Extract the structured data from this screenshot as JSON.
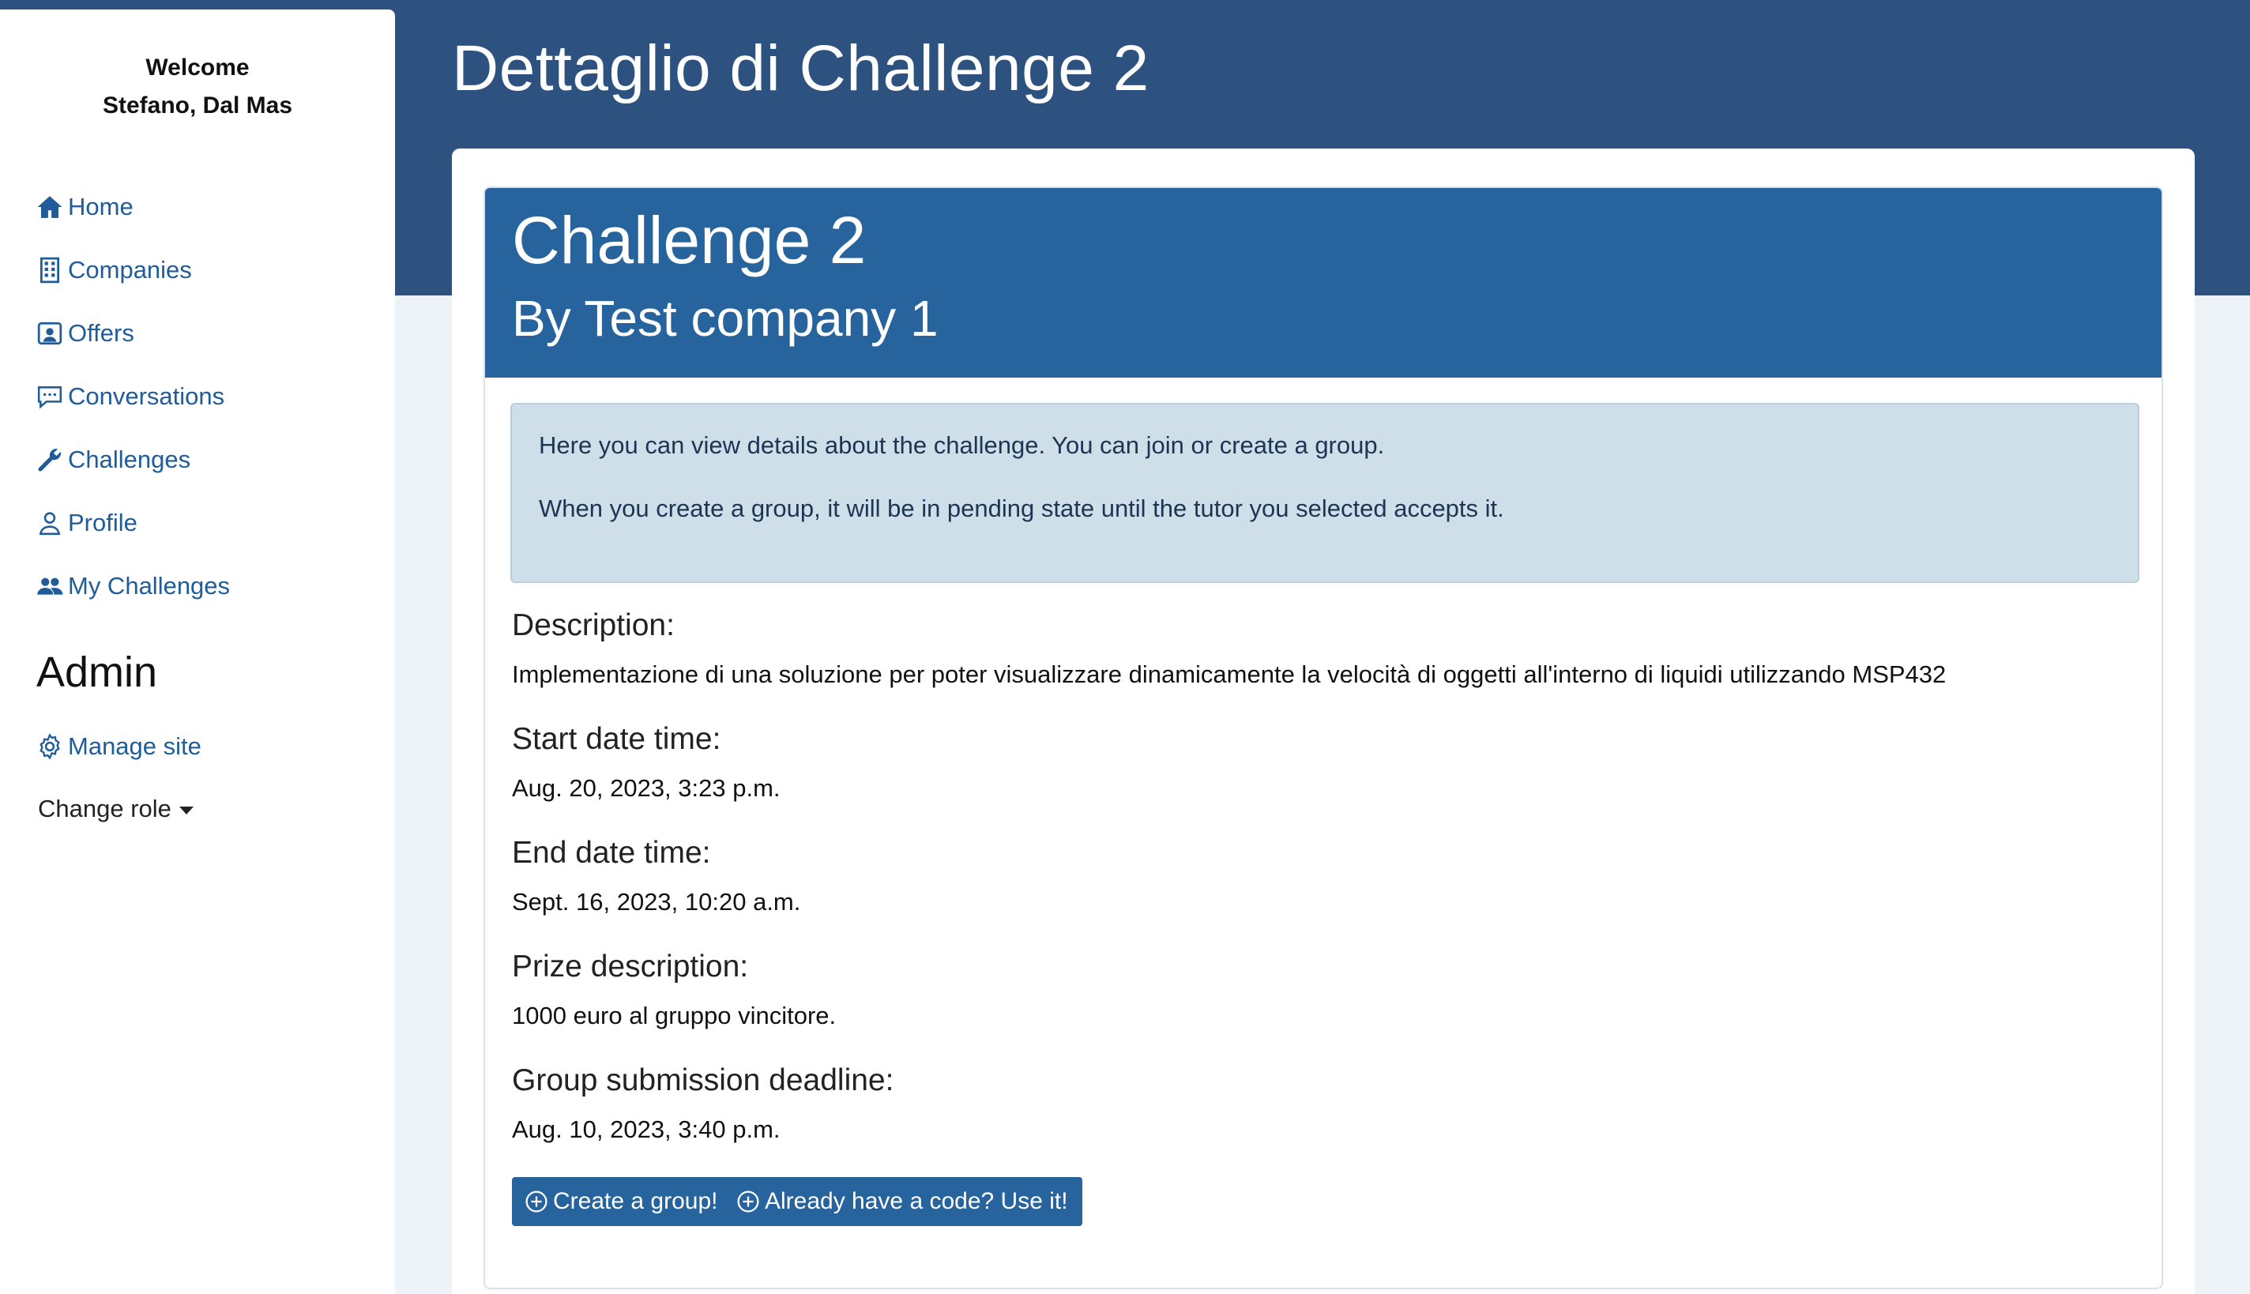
{
  "sidebar": {
    "welcome_line1": "Welcome",
    "welcome_line2": "Stefano, Dal Mas",
    "items": [
      {
        "label": "Home",
        "icon": "home-icon"
      },
      {
        "label": "Companies",
        "icon": "building-icon"
      },
      {
        "label": "Offers",
        "icon": "person-badge-icon"
      },
      {
        "label": "Conversations",
        "icon": "chat-icon"
      },
      {
        "label": "Challenges",
        "icon": "wrench-icon"
      },
      {
        "label": "Profile",
        "icon": "person-icon"
      },
      {
        "label": "My Challenges",
        "icon": "people-icon"
      }
    ],
    "admin_title": "Admin",
    "manage_site": "Manage site",
    "change_role": "Change role"
  },
  "page": {
    "title": "Dettaglio di Challenge 2"
  },
  "challenge": {
    "title": "Challenge 2",
    "subtitle": "By Test company 1",
    "info_line1": "Here you can view details about the challenge. You can join or create a group.",
    "info_line2": "When you create a group, it will be in pending state until the tutor you selected accepts it.",
    "description_label": "Description:",
    "description": "Implementazione di una soluzione per poter visualizzare dinamicamente la velocità di oggetti all'interno di liquidi utilizzando MSP432",
    "start_label": "Start date time:",
    "start": "Aug. 20, 2023, 3:23 p.m.",
    "end_label": "End date time:",
    "end": "Sept. 16, 2023, 10:20 a.m.",
    "prize_label": "Prize description:",
    "prize": "1000 euro al gruppo vincitore.",
    "deadline_label": "Group submission deadline:",
    "deadline": "Aug. 10, 2023, 3:40 p.m.",
    "create_group_button": "Create a group!",
    "use_code_button": "Already have a code? Use it!"
  },
  "colors": {
    "header_band": "#2e527f",
    "card_header": "#27649e",
    "link": "#1f5c99",
    "info_bg": "#cfdfea"
  }
}
